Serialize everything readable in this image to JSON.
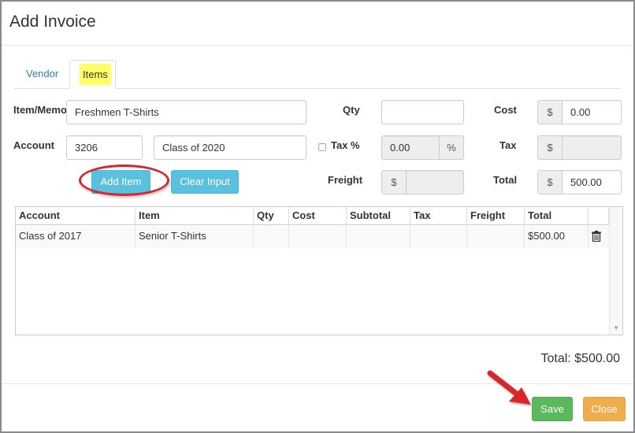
{
  "dialog": {
    "title": "Add Invoice"
  },
  "tabs": [
    {
      "label": "Vendor"
    },
    {
      "label": "Items"
    }
  ],
  "form": {
    "item_memo": {
      "label": "Item/Memo",
      "value": "Freshmen T-Shirts"
    },
    "account": {
      "label": "Account",
      "number": "3206",
      "name": "Class of 2020"
    },
    "qty": {
      "label": "Qty",
      "value": ""
    },
    "cost": {
      "label": "Cost",
      "prefix": "$",
      "value": "0.00"
    },
    "tax_percent": {
      "label": "Tax %",
      "value": "0.00",
      "suffix": "%"
    },
    "tax": {
      "label": "Tax",
      "prefix": "$",
      "value": ""
    },
    "freight": {
      "label": "Freight",
      "prefix": "$",
      "value": ""
    },
    "total": {
      "label": "Total",
      "prefix": "$",
      "value": "500.00"
    },
    "add_item_label": "Add Item",
    "clear_input_label": "Clear Input"
  },
  "table": {
    "columns": [
      "Account",
      "Item",
      "Qty",
      "Cost",
      "Subtotal",
      "Tax",
      "Freight",
      "Total"
    ],
    "rows": [
      [
        "Class of 2017",
        "Senior T-Shirts",
        "",
        "",
        "",
        "",
        "",
        "$500.00"
      ]
    ]
  },
  "summary": {
    "total_text": "Total: $500.00"
  },
  "footer": {
    "save_label": "Save",
    "close_label": "Close"
  },
  "colors": {
    "tab_highlight": "#ffff66",
    "annotation_red": "#d9262b",
    "save_green": "#5cb85c",
    "close_orange": "#f0ad4e",
    "info_blue": "#5bc0de"
  }
}
